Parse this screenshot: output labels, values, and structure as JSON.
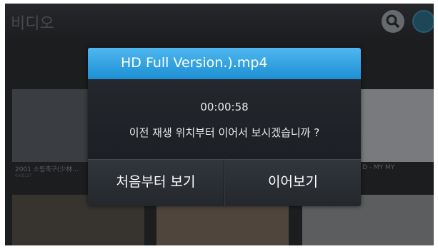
{
  "app": {
    "title": "비디오"
  },
  "toolbar": {
    "search_icon": "search-icon",
    "account_icon": "circle-icon"
  },
  "thumbnails": [
    {
      "label": "2001 소림축구(少林...",
      "sub": "0:05:27"
    },
    {
      "label": "D - MY MY",
      "sub": ""
    }
  ],
  "dialog": {
    "title": "HD Full Version.).mp4",
    "time": "00:00:58",
    "message": "이전 재생 위치부터 이어서 보시겠습니까 ?",
    "buttons": {
      "start_over": "처음부터 보기",
      "resume": "이어보기"
    }
  },
  "colors": {
    "header_blue": "#2a9ee0",
    "dialog_bg": "#1f2328"
  }
}
